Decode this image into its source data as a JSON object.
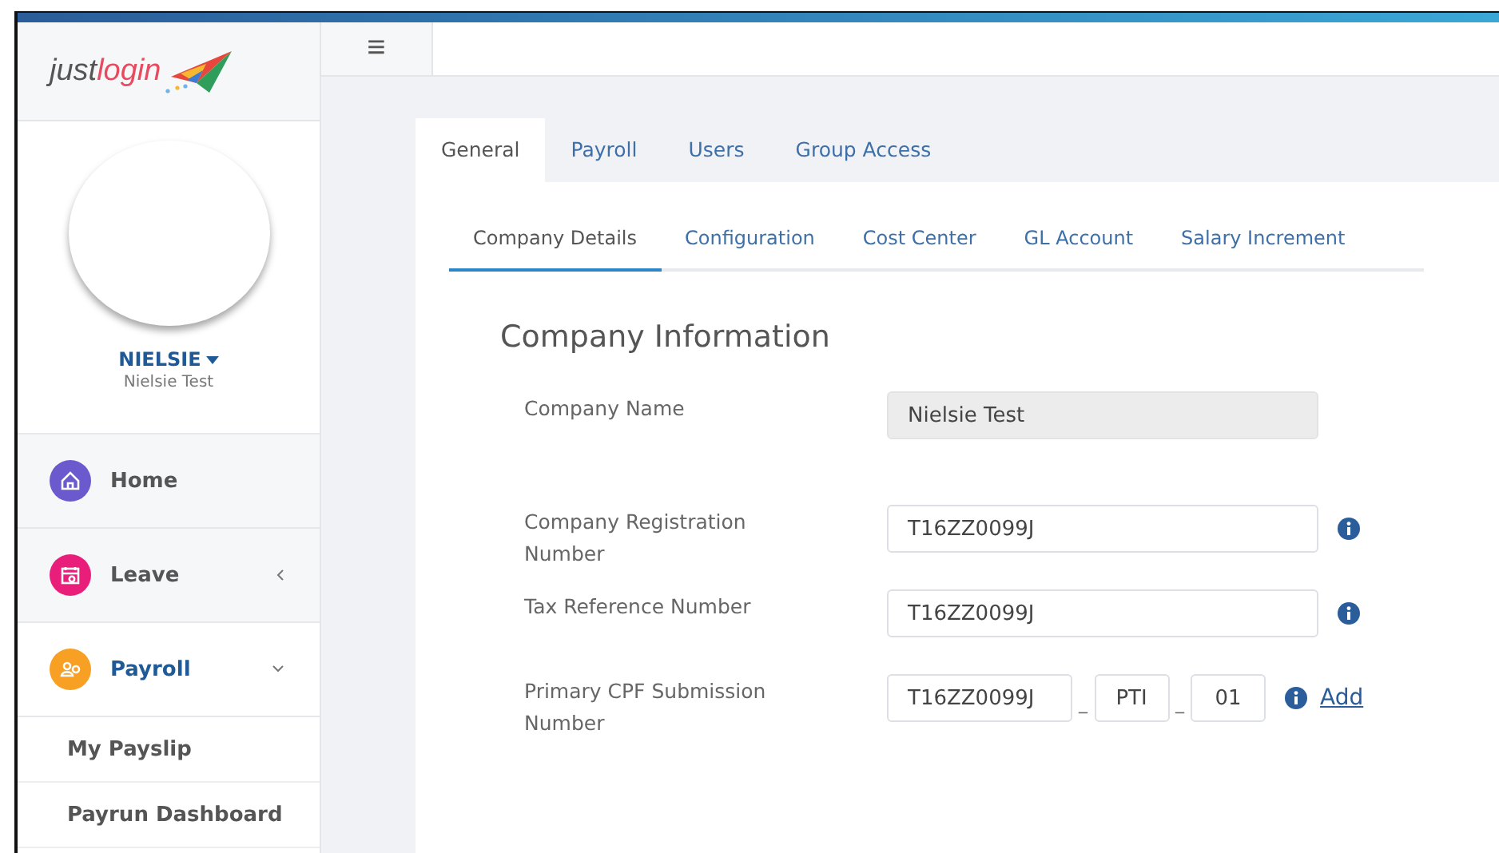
{
  "logo": {
    "part_1": "just",
    "part_2": "login"
  },
  "menu_button": {
    "glyph": "≡"
  },
  "profile": {
    "username": "NIELSIE",
    "full_name": "Nielsie Test",
    "menu_open": false
  },
  "sidebar": {
    "items": [
      {
        "label": "Home",
        "color": "#6a5acd",
        "kind": "home",
        "selected": false
      },
      {
        "label": "Leave",
        "color": "#e91e7a",
        "kind": "calendar",
        "selected": false,
        "expanded": false
      },
      {
        "label": "Payroll",
        "color": "#f7a024",
        "kind": "people",
        "selected": true,
        "expanded": true,
        "children": [
          {
            "label": "My Payslip"
          },
          {
            "label": "Payrun Dashboard"
          }
        ]
      }
    ]
  },
  "tabs": [
    {
      "label": "General",
      "selected": true
    },
    {
      "label": "Payroll",
      "selected": false
    },
    {
      "label": "Users",
      "selected": false
    },
    {
      "label": "Group Access",
      "selected": false
    }
  ],
  "subtabs": [
    {
      "label": "Company Details",
      "selected": true
    },
    {
      "label": "Configuration",
      "selected": false
    },
    {
      "label": "Cost Center",
      "selected": false
    },
    {
      "label": "GL Account",
      "selected": false
    },
    {
      "label": "Salary Increment",
      "selected": false
    }
  ],
  "section_title": "Company Information",
  "fields": [
    {
      "kind": "text",
      "label": "Company Name",
      "value": "Nielsie Test",
      "disabled": true,
      "info": false
    },
    {
      "kind": "text",
      "label": "Company Registration Number",
      "value": "T16ZZ0099J",
      "disabled": false,
      "info": true
    },
    {
      "kind": "text",
      "label": "Tax Reference Number",
      "value": "T16ZZ0099J",
      "disabled": false,
      "info": true
    },
    {
      "kind": "composite",
      "label": "Primary CPF Submission Number",
      "parts": [
        "T16ZZ0099J",
        "PTI",
        "01"
      ],
      "separator": "_",
      "info": true,
      "link": "Add"
    }
  ]
}
